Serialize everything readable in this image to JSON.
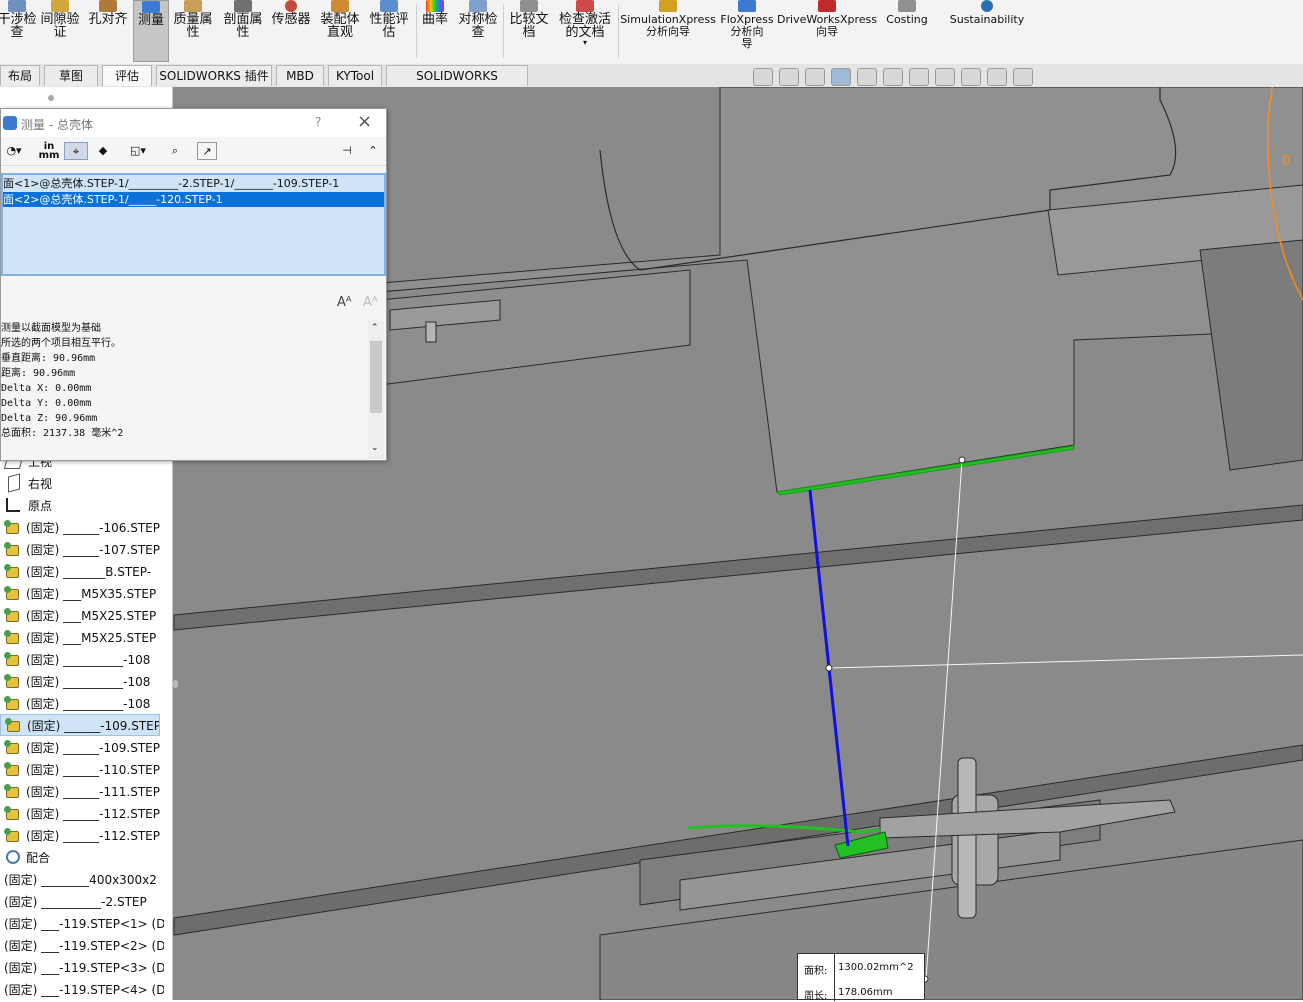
{
  "ribbon": {
    "buttons": [
      {
        "id": "interference",
        "label": "干涉检\n查"
      },
      {
        "id": "clearance",
        "label": "间隙验\n证"
      },
      {
        "id": "hole-align",
        "label": "孔对齐"
      },
      {
        "id": "measure",
        "label": "测量"
      },
      {
        "id": "mass-props",
        "label": "质量属\n性"
      },
      {
        "id": "section-props",
        "label": "剖面属\n性"
      },
      {
        "id": "sensor",
        "label": "传感器"
      },
      {
        "id": "assembly-viz",
        "label": "装配体\n直观"
      },
      {
        "id": "perf-eval",
        "label": "性能评\n估"
      },
      {
        "id": "curvature",
        "label": "曲率"
      },
      {
        "id": "symmetry",
        "label": "对称检\n查"
      },
      {
        "id": "compare",
        "label": "比较文\n档"
      },
      {
        "id": "check-active",
        "label": "检查激活\n的文档"
      },
      {
        "id": "simxpress",
        "label": "SimulationXpress\n分析向导"
      },
      {
        "id": "floxpress",
        "label": "FloXpress\n分析向\n导"
      },
      {
        "id": "driveworks",
        "label": "DriveWorksXpress\n向导"
      },
      {
        "id": "costing",
        "label": "Costing"
      },
      {
        "id": "sustainability",
        "label": "Sustainability"
      }
    ]
  },
  "tabs": [
    "布局",
    "草图",
    "评估",
    "SOLIDWORKS 插件",
    "MBD",
    "KYTool",
    "SOLIDWORKS Inspection"
  ],
  "dialog": {
    "title": "测量 - 总壳体",
    "help": "?",
    "close": "×",
    "unit_label_top": "in",
    "unit_label_bottom": "mm",
    "selections": [
      "面<1>@总壳体.STEP-1/_________-2.STEP-1/_______-109.STEP-1",
      "面<2>@总壳体.STEP-1/_____-120.STEP-1"
    ],
    "results": [
      "测量以截面模型为基础",
      "所选的两个项目相互平行。",
      "垂直距离: 90.96mm",
      "距离: 90.96mm",
      "Delta X: 0.00mm",
      "Delta Y: 0.00mm",
      "Delta Z: 90.96mm",
      "总面积: 2137.38 毫米^2"
    ]
  },
  "tree": {
    "items": [
      {
        "kind": "plane",
        "text": "上视"
      },
      {
        "kind": "plane",
        "text": "右视"
      },
      {
        "kind": "origin",
        "text": "原点"
      },
      {
        "kind": "part",
        "text": "(固定) ______-106.STEP"
      },
      {
        "kind": "part",
        "text": "(固定) ______-107.STEP"
      },
      {
        "kind": "part",
        "text": "(固定) _______B.STEP-"
      },
      {
        "kind": "part",
        "text": "(固定) ___M5X35.STEP"
      },
      {
        "kind": "part",
        "text": "(固定) ___M5X25.STEP"
      },
      {
        "kind": "part",
        "text": "(固定) ___M5X25.STEP"
      },
      {
        "kind": "part",
        "text": "(固定) __________-108"
      },
      {
        "kind": "part",
        "text": "(固定) __________-108"
      },
      {
        "kind": "part",
        "text": "(固定) __________-108"
      },
      {
        "kind": "part",
        "text": "(固定) ______-109.STEP",
        "selected": true
      },
      {
        "kind": "part",
        "text": "(固定) ______-109.STEP"
      },
      {
        "kind": "part",
        "text": "(固定) ______-110.STEP"
      },
      {
        "kind": "part",
        "text": "(固定) ______-111.STEP"
      },
      {
        "kind": "part",
        "text": "(固定) ______-112.STEP"
      },
      {
        "kind": "part",
        "text": "(固定) ______-112.STEP"
      },
      {
        "kind": "mate",
        "text": "配合"
      },
      {
        "kind": "plain",
        "text": "(固定) ________400x300x2"
      },
      {
        "kind": "plain",
        "text": "(固定) __________-2.STEP"
      },
      {
        "kind": "plain",
        "text": "(固定) ___-119.STEP<1> (D"
      },
      {
        "kind": "plain",
        "text": "(固定) ___-119.STEP<2> (D"
      },
      {
        "kind": "plain",
        "text": "(固定) ___-119.STEP<3> (D"
      },
      {
        "kind": "plain",
        "text": "(固定) ___-119.STEP<4> (D"
      }
    ]
  },
  "callout": {
    "area_label": "面积:",
    "area_value": "1300.02mm^2",
    "perimeter_label": "周长:",
    "perimeter_value": "178.06mm"
  },
  "colors": {
    "measure_line": "#1010e0",
    "selected_face": "#22c022",
    "model_face": "#8a8a8a",
    "model_edge": "#2a2a2a",
    "selection_blue": "#0a72d8"
  },
  "viewport": {
    "edge_label": "0"
  }
}
